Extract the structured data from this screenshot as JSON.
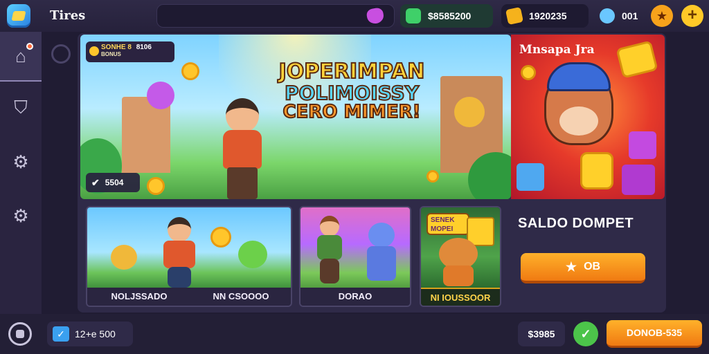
{
  "header": {
    "app_title": "Tires",
    "balance_green": "$8585200",
    "balance_coins": "1920235",
    "balance_gems": "001",
    "icons": [
      "app-logo-icon",
      "gem-icon",
      "green-token-icon",
      "coin-icon",
      "diamond-icon",
      "star-icon",
      "plus-icon"
    ]
  },
  "sidebar": {
    "items": [
      {
        "name": "home",
        "icon": "home-icon"
      },
      {
        "name": "shield",
        "icon": "shield-icon"
      },
      {
        "name": "settings-1",
        "icon": "gear-icon"
      },
      {
        "name": "settings-2",
        "icon": "gear-icon"
      }
    ]
  },
  "hero": {
    "ticket_label": "SONHE 8",
    "ticket_value": "8106",
    "ticket_sub": "BONUS",
    "title_line1": "JOPERIMPAN",
    "title_line2": "POLIMOISSY",
    "title_line3": "CERO MIMER!",
    "badge_value": "5504"
  },
  "promo": {
    "title": "Mnsapa Jra"
  },
  "cards": [
    {
      "label": "NOLJSSADO"
    },
    {
      "label": "NN CSOOOO"
    },
    {
      "label": "DORAO"
    },
    {
      "label": "NI IOUSSOOR",
      "tag": "SENEK MOPEI"
    }
  ],
  "wallet": {
    "title": "SALDO DOMPET",
    "button_label": "OB"
  },
  "bottombar": {
    "left_value": "12+e  500",
    "coins": "$3985",
    "cta_label": "DONOB-535"
  },
  "colors": {
    "accent_orange": "#f5951c",
    "background": "#2a2440",
    "panel": "#2f2a48",
    "green": "#4cc44a"
  }
}
